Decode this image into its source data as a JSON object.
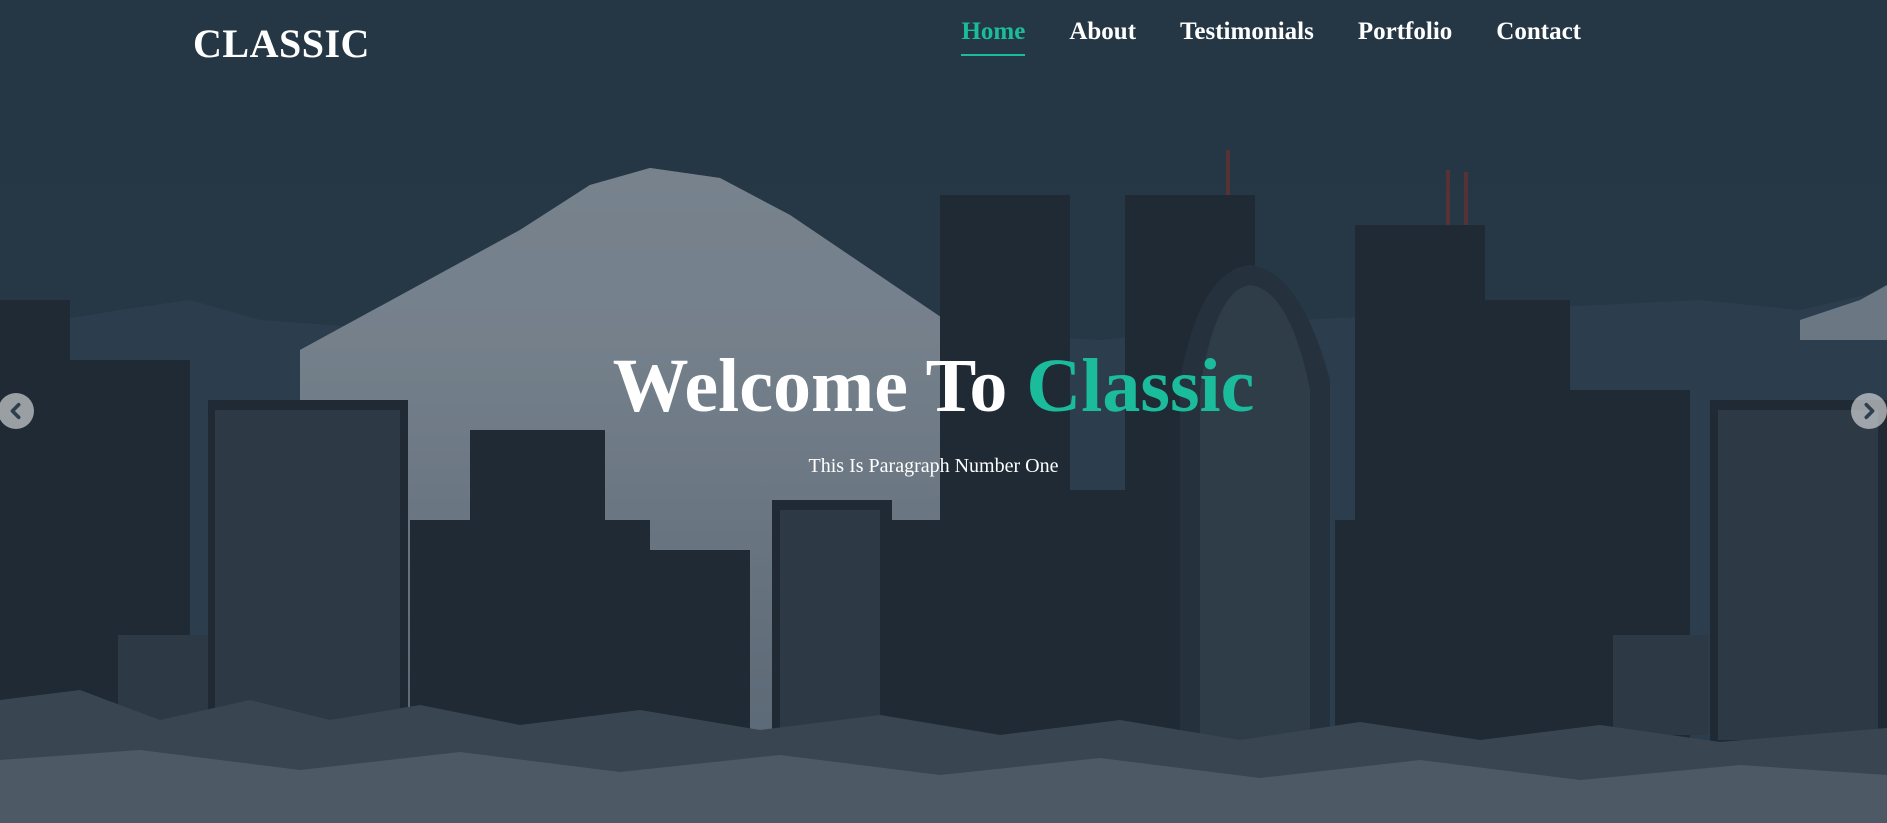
{
  "brand": {
    "name": "CLASSIC"
  },
  "nav": {
    "items": [
      {
        "label": "Home",
        "active": true
      },
      {
        "label": "About",
        "active": false
      },
      {
        "label": "Testimonials",
        "active": false
      },
      {
        "label": "Portfolio",
        "active": false
      },
      {
        "label": "Contact",
        "active": false
      }
    ]
  },
  "hero": {
    "headline_main": "Welcome To",
    "headline_accent": "Classic",
    "paragraph": "This Is Paragraph Number One"
  },
  "carousel": {
    "prev_icon": "chevron-left-icon",
    "next_icon": "chevron-right-icon"
  },
  "colors": {
    "accent": "#1abc9c",
    "text": "#ffffff",
    "background": "#2d3f4d"
  }
}
